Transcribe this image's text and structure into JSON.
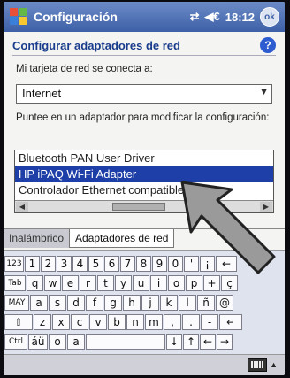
{
  "titlebar": {
    "app_title": "Configuración",
    "time": "18:12",
    "ok_label": "ok",
    "connectivity_glyph": "⇄",
    "volume_glyph": "◀€"
  },
  "page": {
    "heading": "Configurar adaptadores de red",
    "help_label": "?",
    "card_label": "Mi tarjeta de red se conecta a:",
    "card_value": "Internet",
    "select_arrow": "▼",
    "list_label": "Puntee en un adaptador para modificar la configuración:",
    "adapters": [
      "Bluetooth PAN User Driver",
      "HP iPAQ Wi-Fi Adapter",
      "Controlador Ethernet compatible con"
    ],
    "selected_index": 1,
    "scroll_left": "◀",
    "scroll_right": "▶",
    "scroll_thumb": "III"
  },
  "tabs": [
    {
      "label": "Inalámbrico",
      "active": false
    },
    {
      "label": "Adaptadores de red",
      "active": true
    }
  ],
  "keyboard": {
    "rows": [
      [
        "123",
        "1",
        "2",
        "3",
        "4",
        "5",
        "6",
        "7",
        "8",
        "9",
        "0",
        "'",
        "¡",
        "←"
      ],
      [
        "Tab",
        "q",
        "w",
        "e",
        "r",
        "t",
        "y",
        "u",
        "i",
        "o",
        "p",
        "+",
        "ç"
      ],
      [
        "MAY",
        "a",
        "s",
        "d",
        "f",
        "g",
        "h",
        "j",
        "k",
        "l",
        "ñ",
        "@"
      ],
      [
        "⇧",
        "z",
        "x",
        "c",
        "v",
        "b",
        "n",
        "m",
        ",",
        ".",
        "-",
        "↵"
      ],
      [
        "Ctrl",
        "áü",
        "o",
        "a",
        "",
        "↓",
        "↑",
        "←",
        "→"
      ]
    ]
  },
  "bottombar": {
    "kb_arrow": "▲"
  }
}
